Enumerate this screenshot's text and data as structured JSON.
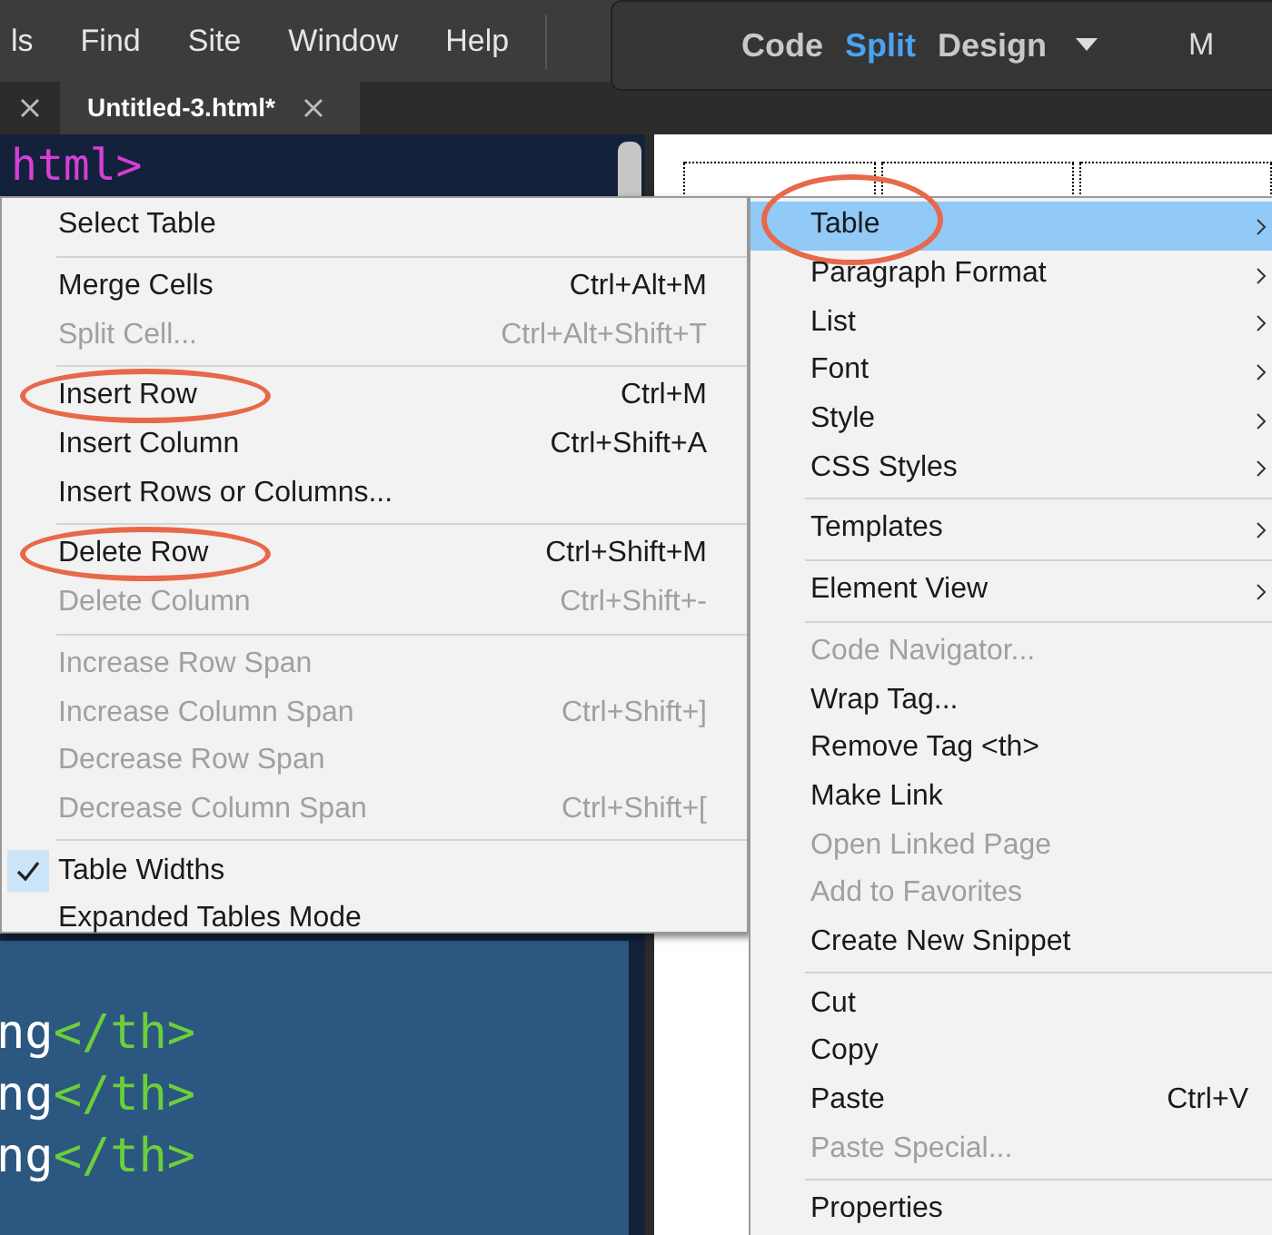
{
  "menubar": {
    "items": [
      "ls",
      "Find",
      "Site",
      "Window",
      "Help"
    ]
  },
  "view_switcher": {
    "options": [
      {
        "label": "Code",
        "selected": false
      },
      {
        "label": "Split",
        "selected": true
      },
      {
        "label": "Design",
        "selected": false
      }
    ],
    "cut_label": "M"
  },
  "tabs": [
    {
      "selected": false
    },
    {
      "label": "Untitled-3.html*",
      "selected": true
    }
  ],
  "code": {
    "top_line": "html>",
    "selected_lines": [
      {
        "text": "ng",
        "tag": "</th>"
      },
      {
        "text": "ng",
        "tag": "</th>"
      },
      {
        "text": "ng",
        "tag": "</th>"
      }
    ]
  },
  "table_menu": {
    "groups": [
      [
        {
          "label": "Select Table",
          "disabled": false,
          "checked": false,
          "circled": false
        }
      ],
      [
        {
          "label": "Merge Cells",
          "shortcut": "Ctrl+Alt+M",
          "disabled": false,
          "checked": false,
          "circled": false
        },
        {
          "label": "Split Cell...",
          "shortcut": "Ctrl+Alt+Shift+T",
          "disabled": true,
          "checked": false,
          "circled": false
        }
      ],
      [
        {
          "label": "Insert Row",
          "shortcut": "Ctrl+M",
          "disabled": false,
          "checked": false,
          "circled": true
        },
        {
          "label": "Insert Column",
          "shortcut": "Ctrl+Shift+A",
          "disabled": false,
          "checked": false,
          "circled": false
        },
        {
          "label": "Insert Rows or Columns...",
          "disabled": false,
          "checked": false,
          "circled": false
        }
      ],
      [
        {
          "label": "Delete Row",
          "shortcut": "Ctrl+Shift+M",
          "disabled": false,
          "checked": false,
          "circled": true
        },
        {
          "label": "Delete Column",
          "shortcut": "Ctrl+Shift+-",
          "disabled": true,
          "checked": false,
          "circled": false
        }
      ],
      [
        {
          "label": "Increase Row Span",
          "disabled": true,
          "checked": false,
          "circled": false
        },
        {
          "label": "Increase Column Span",
          "shortcut": "Ctrl+Shift+]",
          "disabled": true,
          "checked": false,
          "circled": false
        },
        {
          "label": "Decrease Row Span",
          "disabled": true,
          "checked": false,
          "circled": false
        },
        {
          "label": "Decrease Column Span",
          "shortcut": "Ctrl+Shift+[",
          "disabled": true,
          "checked": false,
          "circled": false
        }
      ],
      [
        {
          "label": "Table Widths",
          "disabled": false,
          "checked": true,
          "circled": false
        },
        {
          "label": "Expanded Tables Mode",
          "disabled": false,
          "checked": false,
          "circled": false
        }
      ]
    ]
  },
  "context_menu": {
    "groups": [
      [
        {
          "label": "Table",
          "submenu": true,
          "disabled": false,
          "selected": true,
          "circled": true
        },
        {
          "label": "Paragraph Format",
          "submenu": true,
          "disabled": false,
          "selected": false,
          "circled": false
        },
        {
          "label": "List",
          "submenu": true,
          "disabled": false,
          "selected": false,
          "circled": false
        },
        {
          "label": "Font",
          "submenu": true,
          "disabled": false,
          "selected": false,
          "circled": false
        },
        {
          "label": "Style",
          "submenu": true,
          "disabled": false,
          "selected": false,
          "circled": false
        },
        {
          "label": "CSS Styles",
          "submenu": true,
          "disabled": false,
          "selected": false,
          "circled": false
        }
      ],
      [
        {
          "label": "Templates",
          "submenu": true,
          "disabled": false,
          "selected": false,
          "circled": false
        }
      ],
      [
        {
          "label": "Element View",
          "submenu": true,
          "disabled": false,
          "selected": false,
          "circled": false
        }
      ],
      [
        {
          "label": "Code Navigator...",
          "submenu": false,
          "disabled": true,
          "selected": false,
          "circled": false
        },
        {
          "label": "Wrap Tag...",
          "submenu": false,
          "disabled": false,
          "selected": false,
          "circled": false
        },
        {
          "label": "Remove Tag <th>",
          "submenu": false,
          "disabled": false,
          "selected": false,
          "circled": false
        },
        {
          "label": "Make Link",
          "submenu": false,
          "disabled": false,
          "selected": false,
          "circled": false
        },
        {
          "label": "Open Linked Page",
          "submenu": false,
          "disabled": true,
          "selected": false,
          "circled": false
        },
        {
          "label": "Add to Favorites",
          "submenu": false,
          "disabled": true,
          "selected": false,
          "circled": false
        },
        {
          "label": "Create New Snippet",
          "submenu": false,
          "disabled": false,
          "selected": false,
          "circled": false
        }
      ],
      [
        {
          "label": "Cut",
          "submenu": false,
          "disabled": false,
          "selected": false,
          "circled": false
        },
        {
          "label": "Copy",
          "submenu": false,
          "disabled": false,
          "selected": false,
          "circled": false
        },
        {
          "label": "Paste",
          "shortcut": "Ctrl+V",
          "submenu": false,
          "disabled": false,
          "selected": false,
          "circled": false
        },
        {
          "label": "Paste Special...",
          "submenu": false,
          "disabled": true,
          "selected": false,
          "circled": false
        }
      ],
      [
        {
          "label": "Properties",
          "submenu": false,
          "disabled": false,
          "selected": false,
          "circled": false
        }
      ]
    ]
  }
}
